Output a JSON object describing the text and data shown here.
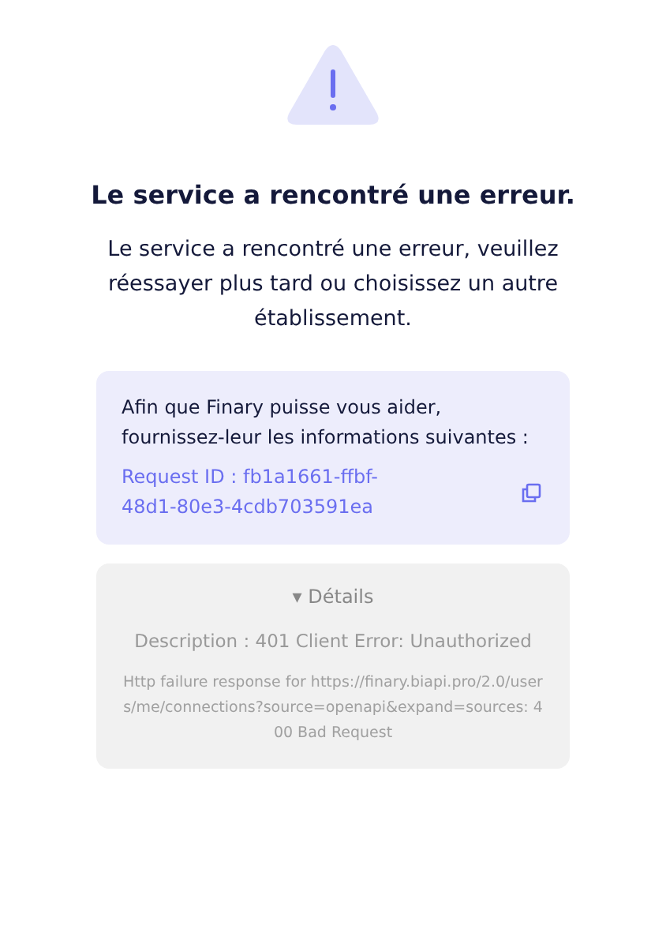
{
  "title": "Le service a rencontré une erreur.",
  "message": "Le service a rencontré une erreur, veuillez réessayer plus tard ou choisissez un autre établissement.",
  "help_card": {
    "text": "Afin que Finary puisse vous aider, fournissez-leur les informations suivantes :",
    "request_id": "Request ID : fb1a1661-ffbf-48d1-80e3-4cdb703591ea"
  },
  "details": {
    "marker": "▾",
    "label": "Détails",
    "expanded": true,
    "description": "Description : 401 Client Error: Unauthorized",
    "error": "Http failure response for https://finary.biapi.pro/2.0/users/me/connections?source=openapi&expand=sources: 400 Bad Request"
  }
}
